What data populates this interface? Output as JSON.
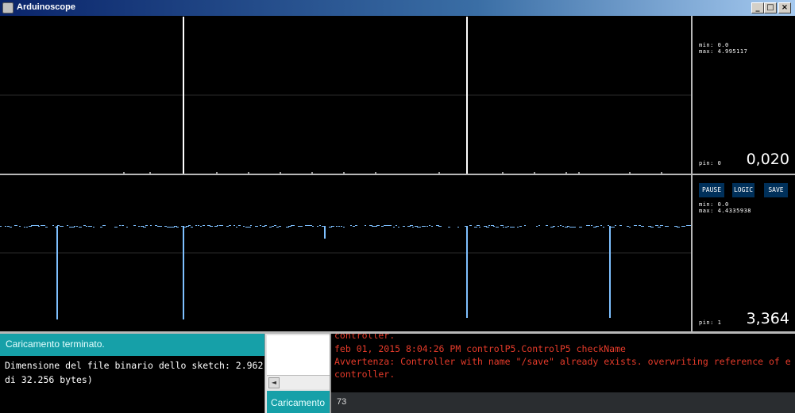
{
  "window": {
    "title": "Arduinoscope",
    "minimize_glyph": "_",
    "maximize_glyph": "□",
    "close_glyph": "×"
  },
  "colors": {
    "trace": "#7ec0ff",
    "grid": "#2a2a2a",
    "control_button_bg": "#00305a",
    "status_teal": "#16a0a8",
    "warning_red": "#e63b2a"
  },
  "channels": [
    {
      "pin_label": "pin: 0",
      "min_label": "min: 0.0",
      "max_label": "max: 4.995117",
      "value": "0,020"
    },
    {
      "pin_label": "pin: 1",
      "min_label": "min: 0.0",
      "max_label": "max: 4.4335938",
      "value": "3,364"
    }
  ],
  "controls": {
    "pause": "PAUSE",
    "logic": "LOGIC",
    "save": "SAVE"
  },
  "ide": {
    "left_status": "Caricamento terminato.",
    "left_console": "Dimensione del file binario dello sketch: 2.962\ndi 32.256 bytes)",
    "mid_status": "Caricamento",
    "scroll_left_glyph": "◄",
    "console_lines": [
      "controller.",
      "feb 01, 2015 8:04:26 PM controlP5.ControlP5 checkName",
      "Avvertenza: Controller with name \"/save\" already exists. overwriting reference of e",
      "controller."
    ],
    "right_status": "73"
  }
}
